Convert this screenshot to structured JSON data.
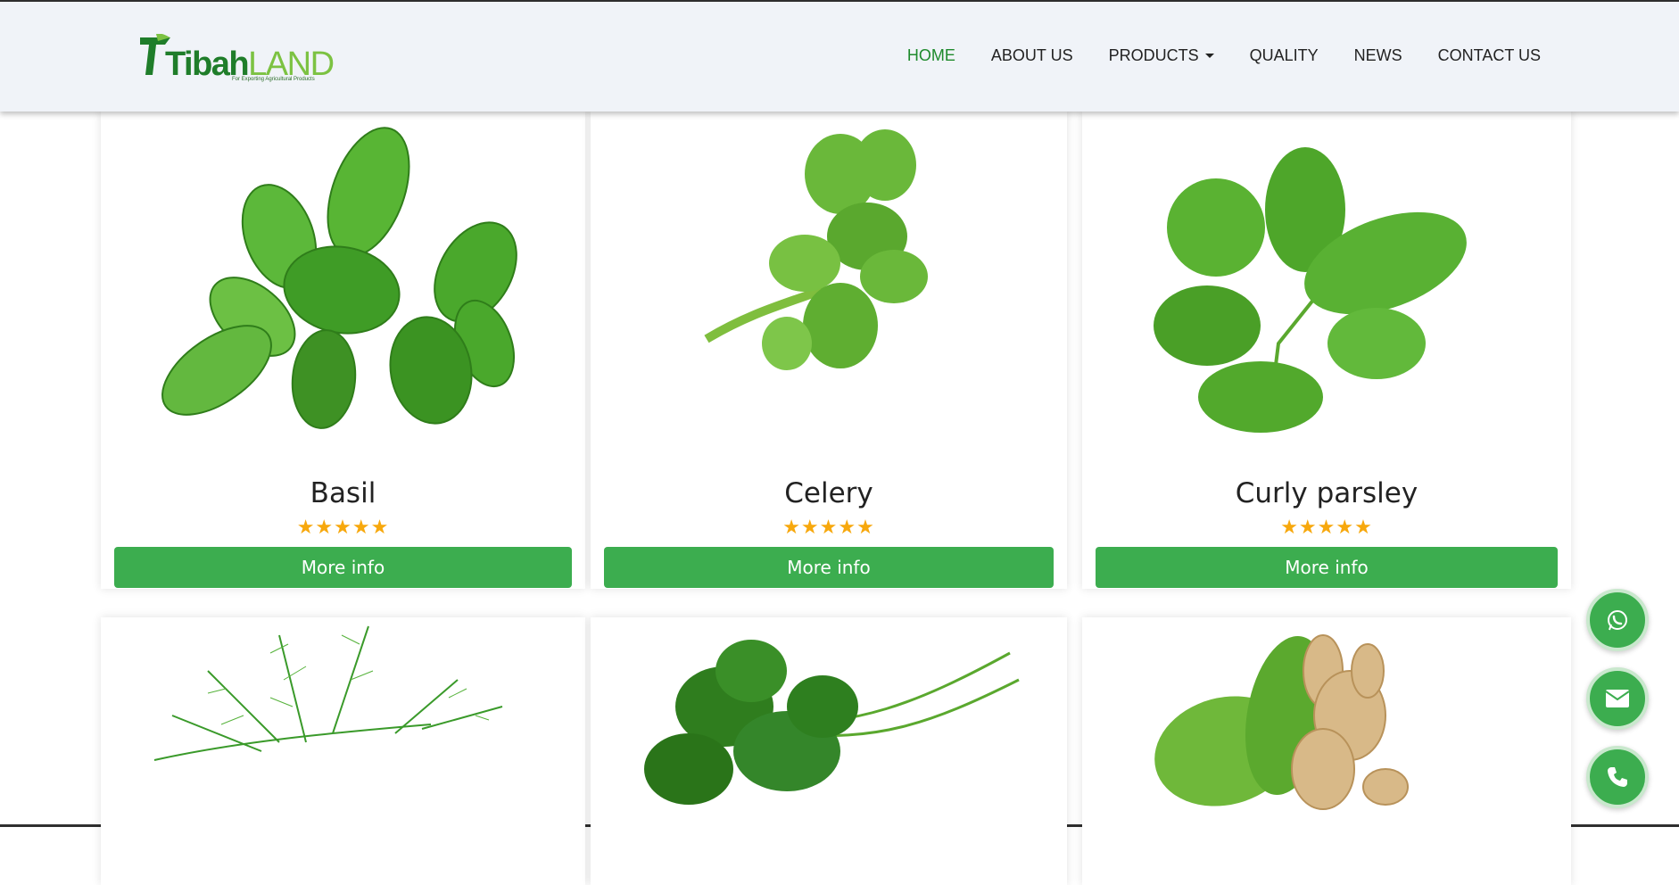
{
  "brand": {
    "name_part1": "Tibah",
    "name_part2": "LAND",
    "tagline": "For Exporting Agricultural Products"
  },
  "nav": [
    {
      "label": "HOME",
      "active": true
    },
    {
      "label": "ABOUT US"
    },
    {
      "label": "PRODUCTS",
      "dropdown": true
    },
    {
      "label": "QUALITY"
    },
    {
      "label": "NEWS"
    },
    {
      "label": "CONTACT US"
    }
  ],
  "products": [
    {
      "name": "Basil",
      "rating": "★★★★★",
      "button": "More info",
      "image": "basil-image"
    },
    {
      "name": "Celery",
      "rating": "★★★★★",
      "button": "More info",
      "image": "celery-image"
    },
    {
      "name": "Curly parsley",
      "rating": "★★★★★",
      "button": "More info",
      "image": "curly-parsley-image"
    },
    {
      "image": "dill-image"
    },
    {
      "image": "parsley-image"
    },
    {
      "image": "ginger-image"
    }
  ],
  "floating": [
    "whatsapp-icon",
    "envelope-icon",
    "phone-icon"
  ],
  "colors": {
    "accent": "#3cad4f",
    "nav_active": "#1e8a2c",
    "star": "#f7a80d",
    "logo_dark": "#1f7d2a",
    "logo_light": "#7cc242"
  }
}
